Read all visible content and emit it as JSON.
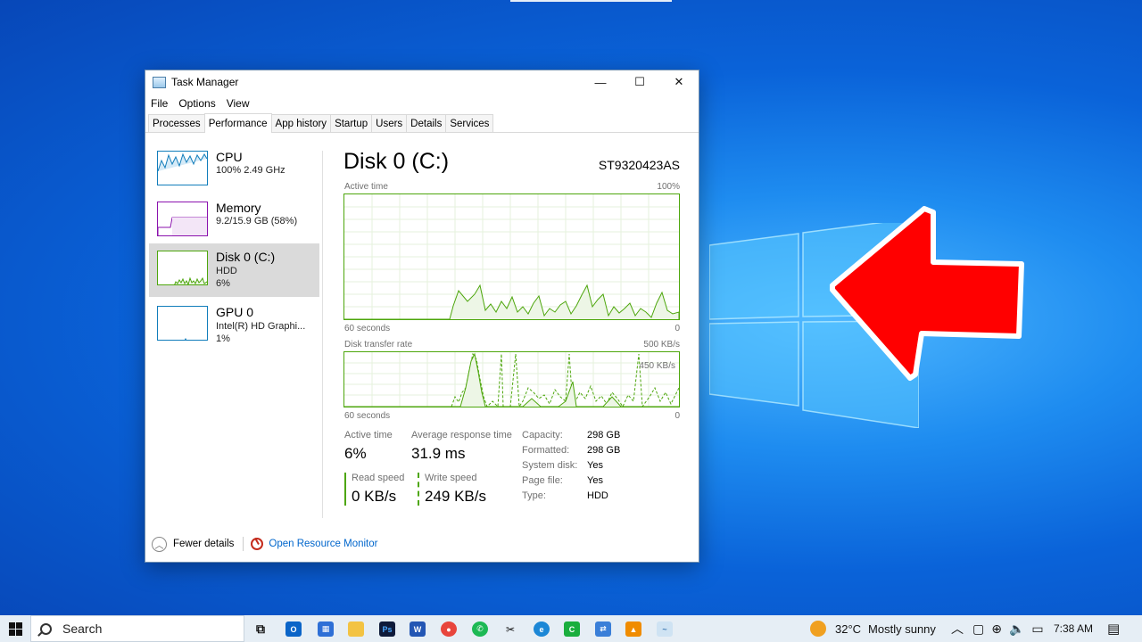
{
  "window": {
    "title": "Task Manager",
    "menu": [
      "File",
      "Options",
      "View"
    ],
    "tabs": [
      "Processes",
      "Performance",
      "App history",
      "Startup",
      "Users",
      "Details",
      "Services"
    ],
    "active_tab": "Performance",
    "controls": {
      "minimize": "—",
      "maximize": "☐",
      "close": "✕"
    }
  },
  "devices": [
    {
      "name": "CPU",
      "line1": "100%  2.49 GHz",
      "line2": "",
      "color": "#117dbb"
    },
    {
      "name": "Memory",
      "line1": "9.2/15.9 GB (58%)",
      "line2": "",
      "color": "#8b12ae"
    },
    {
      "name": "Disk 0 (C:)",
      "line1": "HDD",
      "line2": "6%",
      "color": "#4da60c",
      "selected": true
    },
    {
      "name": "GPU 0",
      "line1": "Intel(R) HD Graphi...",
      "line2": "1%",
      "color": "#117dbb"
    }
  ],
  "detail": {
    "title": "Disk 0 (C:)",
    "model": "ST9320423AS",
    "graph1": {
      "label": "Active time",
      "max": "100%",
      "time": "60 seconds",
      "min": "0"
    },
    "graph2": {
      "label": "Disk transfer rate",
      "max": "500 KB/s",
      "mid": "450 KB/s",
      "time": "60 seconds",
      "min": "0"
    },
    "stats": {
      "active_time_label": "Active time",
      "active_time": "6%",
      "avg_resp_label": "Average response time",
      "avg_resp": "31.9 ms",
      "read_label": "Read speed",
      "read": "0 KB/s",
      "write_label": "Write speed",
      "write": "249 KB/s"
    },
    "properties": [
      {
        "k": "Capacity:",
        "v": "298 GB"
      },
      {
        "k": "Formatted:",
        "v": "298 GB"
      },
      {
        "k": "System disk:",
        "v": "Yes"
      },
      {
        "k": "Page file:",
        "v": "Yes"
      },
      {
        "k": "Type:",
        "v": "HDD"
      }
    ]
  },
  "footer": {
    "fewer": "Fewer details",
    "resource_monitor": "Open Resource Monitor"
  },
  "taskbar": {
    "search_placeholder": "Search",
    "weather_temp": "32°C",
    "weather_text": "Mostly sunny",
    "time": "7:38 AM"
  }
}
